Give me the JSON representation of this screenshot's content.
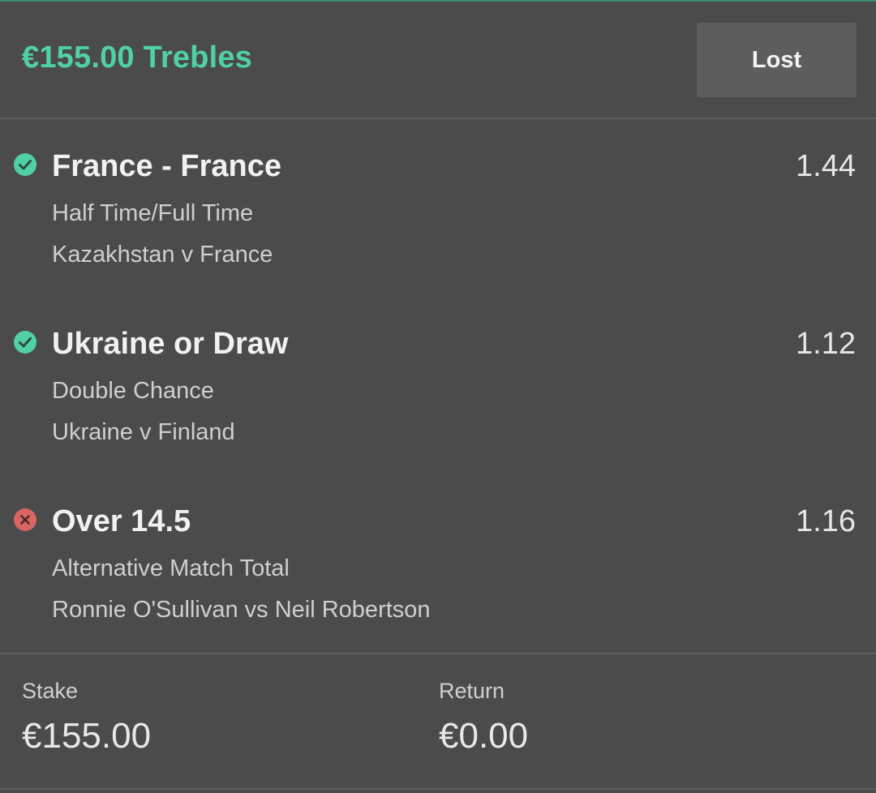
{
  "bet": {
    "title": "€155.00 Trebles",
    "status": "Lost"
  },
  "selections": [
    {
      "name": "France - France",
      "odds": "1.44",
      "market": "Half Time/Full Time",
      "event": "Kazakhstan v France",
      "result": "won",
      "icon": "check-circle-icon"
    },
    {
      "name": "Ukraine or Draw",
      "odds": "1.12",
      "market": "Double Chance",
      "event": "Ukraine v Finland",
      "result": "won",
      "icon": "check-circle-icon"
    },
    {
      "name": "Over 14.5",
      "odds": "1.16",
      "market": "Alternative Match Total",
      "event": "Ronnie O'Sullivan vs Neil Robertson",
      "result": "lost",
      "icon": "cross-circle-icon"
    }
  ],
  "summary": {
    "stake_label": "Stake",
    "stake_value": "€155.00",
    "return_label": "Return",
    "return_value": "€0.00"
  },
  "colors": {
    "accent": "#4fd1a5",
    "won": "#4fd1a5",
    "lost": "#d96464",
    "background": "#4b4b4b"
  }
}
